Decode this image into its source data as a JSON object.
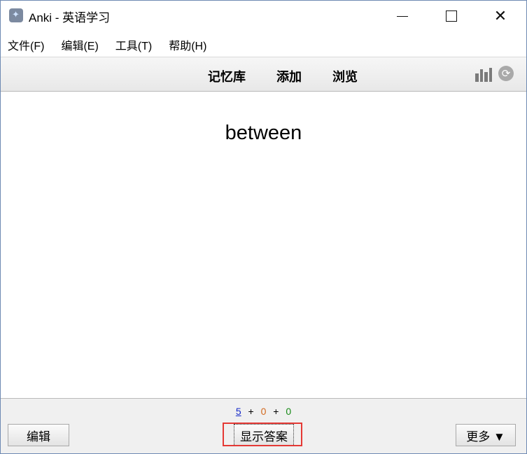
{
  "window": {
    "title": "Anki - 英语学习",
    "min_glyph": "—",
    "max_glyph": "☐",
    "close_glyph": "✕"
  },
  "menu": {
    "items": [
      {
        "label": "文件(F)"
      },
      {
        "label": "编辑(E)"
      },
      {
        "label": "工具(T)"
      },
      {
        "label": "帮助(H)"
      }
    ]
  },
  "toolbar": {
    "decks": "记忆库",
    "add": "添加",
    "browse": "浏览",
    "icons": [
      "stats-icon",
      "sync-icon"
    ]
  },
  "card": {
    "front": "between"
  },
  "counts": {
    "new": "5",
    "learning": "0",
    "review": "0",
    "plus": "+",
    "colors": {
      "new": "#1428c8",
      "learning": "#d2691e",
      "review": "#178a17"
    }
  },
  "bottom": {
    "edit": "编辑",
    "show_answer": "显示答案",
    "more": "更多 ▼"
  },
  "colors": {
    "highlight": "#e53935",
    "toolbar_border": "#b9b9b9"
  }
}
